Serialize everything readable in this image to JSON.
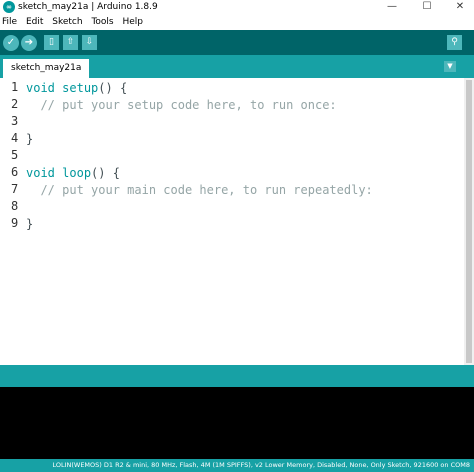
{
  "window": {
    "title": "sketch_may21a | Arduino 1.8.9",
    "minimize_glyph": "—",
    "maximize_glyph": "☐",
    "close_glyph": "✕"
  },
  "menu": [
    "File",
    "Edit",
    "Sketch",
    "Tools",
    "Help"
  ],
  "toolbar": {
    "verify_icon": "✓",
    "upload_icon": "➔",
    "new_icon": "▯",
    "open_icon": "⇧",
    "save_icon": "⇩",
    "serial_monitor_icon": "⚲"
  },
  "tabs": [
    {
      "label": "sketch_may21a"
    }
  ],
  "tab_menu_icon": "▼",
  "editor": {
    "line_numbers": [
      "1",
      "2",
      "3",
      "4",
      "5",
      "6",
      "7",
      "8",
      "9"
    ],
    "lines": [
      {
        "kw": "void",
        "fn": "setup",
        "rest": "() {"
      },
      {
        "comment": "  // put your setup code here, to run once:"
      },
      {
        "text": ""
      },
      {
        "text": "}"
      },
      {
        "text": ""
      },
      {
        "kw": "void",
        "fn": "loop",
        "rest": "() {"
      },
      {
        "comment": "  // put your main code here, to run repeatedly:"
      },
      {
        "text": ""
      },
      {
        "text": "}"
      }
    ]
  },
  "status_bar": {
    "board_info": "LOLIN(WEMOS) D1 R2 & mini, 80 MHz, Flash, 4M (1M SPIFFS), v2 Lower Memory, Disabled, None, Only Sketch, 921600 on COM8"
  },
  "colors": {
    "toolbar": "#006468",
    "tabbar": "#17a1a5",
    "keyword": "#00979c",
    "comment": "#95a5a6"
  }
}
